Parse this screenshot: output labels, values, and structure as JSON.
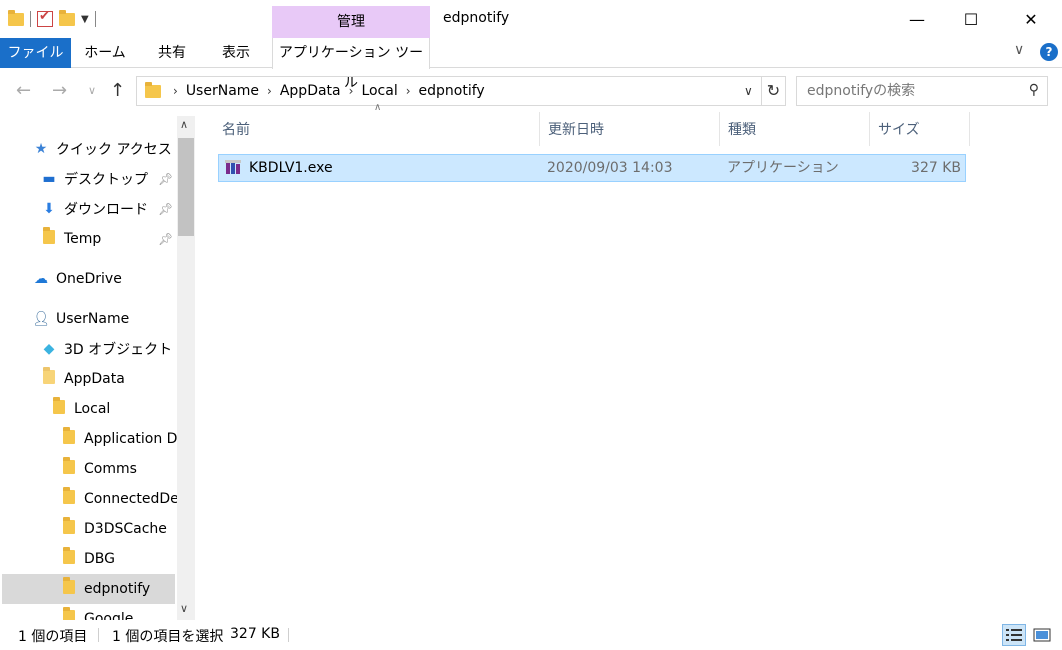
{
  "window": {
    "title": "edpnotify",
    "context_tab_header": "管理",
    "minimize_glyph": "—",
    "maximize_glyph": "☐",
    "close_glyph": "✕"
  },
  "ribbon": {
    "tabs": [
      "ファイル",
      "ホーム",
      "共有",
      "表示",
      "アプリケーション ツール"
    ]
  },
  "address": {
    "crumbs": [
      "UserName",
      "AppData",
      "Local",
      "edpnotify"
    ],
    "search_placeholder": "edpnotifyの検索"
  },
  "nav_pane": {
    "quick_access": "クイック アクセス",
    "desktop": "デスクトップ",
    "downloads": "ダウンロード",
    "temp": "Temp",
    "onedrive": "OneDrive",
    "username": "UserName",
    "objects3d": "3D オブジェクト",
    "appdata": "AppData",
    "local": "Local",
    "application_data": "Application D",
    "comms": "Comms",
    "connecteddevices": "ConnectedDe",
    "d3dscache": "D3DSCache",
    "dbg": "DBG",
    "edpnotify": "edpnotify",
    "google": "Google"
  },
  "columns": {
    "name": "名前",
    "modified": "更新日時",
    "type": "種類",
    "size": "サイズ"
  },
  "files": [
    {
      "name": "KBDLV1.exe",
      "modified": "2020/09/03 14:03",
      "type": "アプリケーション",
      "size": "327 KB"
    }
  ],
  "status": {
    "item_count": "1 個の項目",
    "selected": "1 個の項目を選択",
    "selected_size": "327 KB"
  },
  "colors": {
    "file_tab": "#1a6fc9",
    "context_tab": "#e8c9f7",
    "selection": "#cce8ff",
    "selection_border": "#99d1ff"
  }
}
